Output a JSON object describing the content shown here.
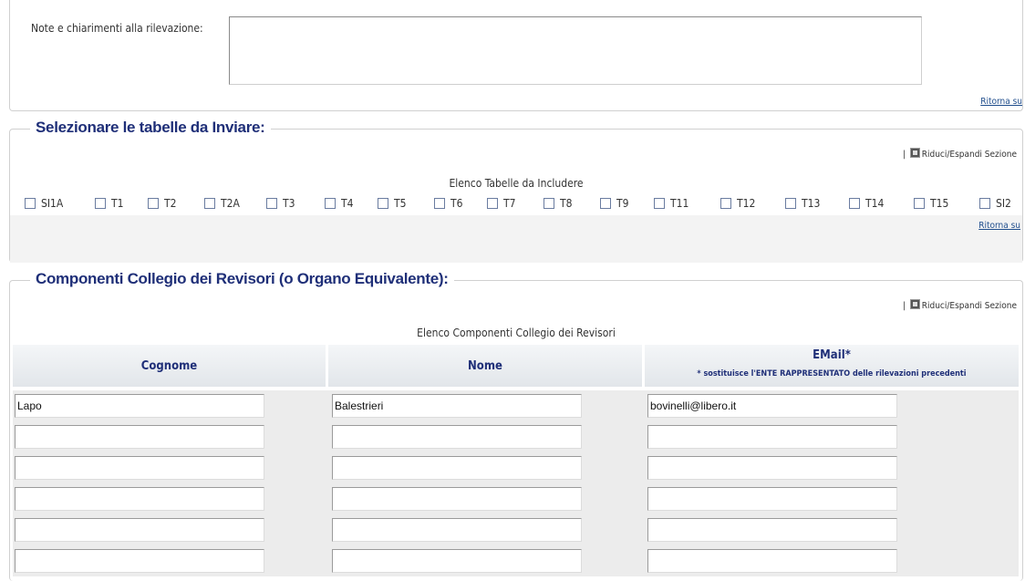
{
  "notes": {
    "label": "Note e chiarimenti alla rilevazione:",
    "value": "",
    "scroll_up": "▲",
    "scroll_down": "▼",
    "return_link": "Ritorna su"
  },
  "tables_section": {
    "legend": "Selezionare le tabelle da Inviare:",
    "toggle_sep": "|",
    "toggle_label": "Riduci/Espandi Sezione",
    "list_title": "Elenco Tabelle da Includere",
    "checkboxes": [
      "SI1A",
      "T1",
      "T2",
      "T2A",
      "T3",
      "T4",
      "T5",
      "T6",
      "T7",
      "T8",
      "T9",
      "T11",
      "T12",
      "T13",
      "T14",
      "T15",
      "SI2"
    ],
    "return_link": "Ritorna su"
  },
  "revisori_section": {
    "legend": "Componenti Collegio dei Revisori (o Organo Equivalente):",
    "toggle_sep": "|",
    "toggle_label": "Riduci/Espandi Sezione",
    "list_title": "Elenco Componenti Collegio dei Revisori",
    "columns": {
      "cognome": "Cognome",
      "nome": "Nome",
      "email": "EMail*",
      "email_note": "* sostituisce l'ENTE RAPPRESENTATO delle rilevazioni precedenti"
    },
    "rows": [
      {
        "cognome": "Lapo",
        "nome": "Balestrieri",
        "email": "bovinelli@libero.it"
      },
      {
        "cognome": "",
        "nome": "",
        "email": ""
      },
      {
        "cognome": "",
        "nome": "",
        "email": ""
      },
      {
        "cognome": "",
        "nome": "",
        "email": ""
      },
      {
        "cognome": "",
        "nome": "",
        "email": ""
      },
      {
        "cognome": "",
        "nome": "",
        "email": ""
      }
    ]
  }
}
